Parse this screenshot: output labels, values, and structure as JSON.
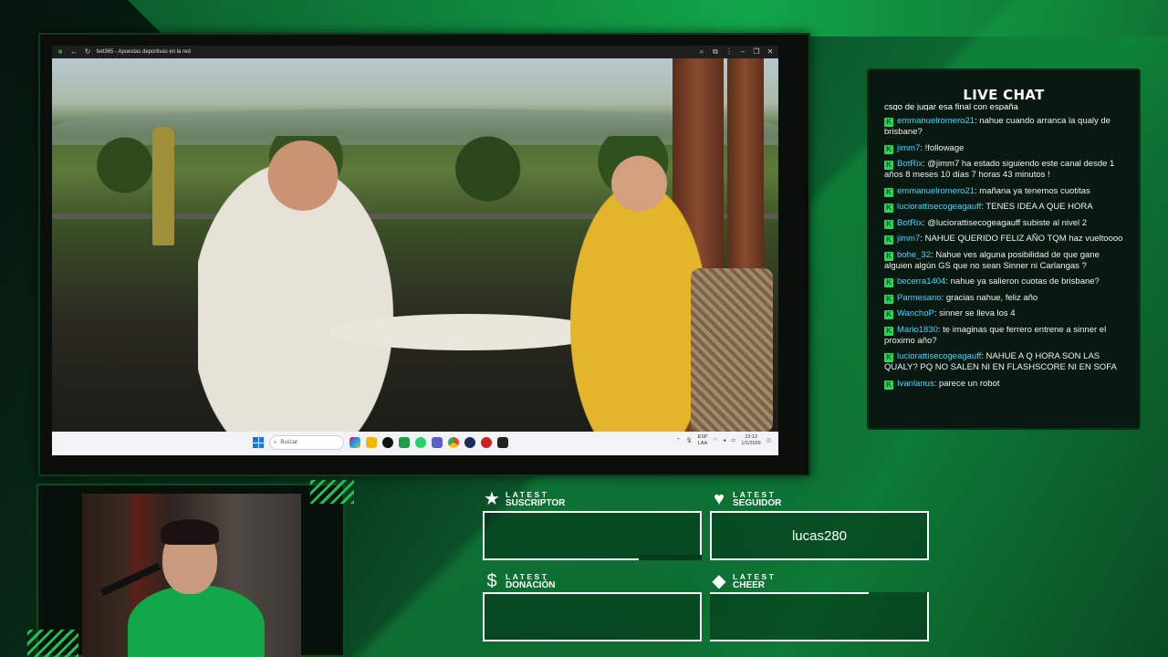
{
  "browser": {
    "title": "bet365 - Apuestas deportivas en la red",
    "taskbar": {
      "search_placeholder": "Buscar",
      "lang_top": "ESP",
      "lang_bottom": "LAA",
      "time": "23:12",
      "date": "1/1/2026"
    }
  },
  "chat": {
    "title": "LIVE CHAT",
    "partial_top": "csgo de jugar esa final con españa",
    "messages": [
      {
        "user": "emmanuelromero21",
        "text": ": nahue cuando arranca la qualy de brisbane?"
      },
      {
        "user": "jimm7",
        "text": ": !followage"
      },
      {
        "user": "BotRix",
        "text": ": @jimm7 ha estado siguiendo este canal desde 1 años 8 meses 10 días 7 horas 43 minutos !"
      },
      {
        "user": "emmanuelromero21",
        "text": ": mañana ya tenemos cuotitas"
      },
      {
        "user": "luciorattisecogeagauff",
        "text": ": TENES IDEA A QUE HORA"
      },
      {
        "user": "BotRix",
        "text": ": @luciorattisecogeagauff subiste al nivel 2"
      },
      {
        "user": "jimm7",
        "text": ": NAHUE QUERIDO FELIZ AÑO TQM haz vueltoooo"
      },
      {
        "user": "bohe_32",
        "text": ": Nahue ves alguna posibilidad de que gane alguien algún GS que no sean Sinner ni Carlangas ?"
      },
      {
        "user": "becerra1404",
        "text": ": nahue ya salieron cuotas de brisbane?"
      },
      {
        "user": "Parmesano",
        "text": ": gracias nahue, feliz año"
      },
      {
        "user": "WanchoP",
        "text": ": sinner se lleva los 4"
      },
      {
        "user": "Mario1830",
        "text": ": te imaginas que ferrero entrene a sinner el proximo año?"
      },
      {
        "user": "luciorattisecogeagauff",
        "text": ": NAHUE A Q HORA SON LAS QUALY? PQ NO SALEN NI EN FLASHSCORE NI EN SOFA"
      },
      {
        "user": "Ivanlanus",
        "text": ": parece un robot"
      }
    ]
  },
  "widgets": {
    "suscriptor": {
      "small": "LATEST",
      "big": "SUSCRIPTOR",
      "value": ""
    },
    "seguidor": {
      "small": "LATEST",
      "big": "SEGUIDOR",
      "value": "lucas280"
    },
    "donacion": {
      "small": "LATEST",
      "big": "DONACIÓN",
      "value": ""
    },
    "cheer": {
      "small": "LATEST",
      "big": "CHEER",
      "value": ""
    }
  },
  "icons": {
    "star": "star-icon",
    "heart": "heart-icon",
    "dollar": "dollar-icon",
    "diamond": "diamond-icon"
  },
  "colors": {
    "accent_green": "#2bd452",
    "username_blue": "#3fd7ff"
  }
}
